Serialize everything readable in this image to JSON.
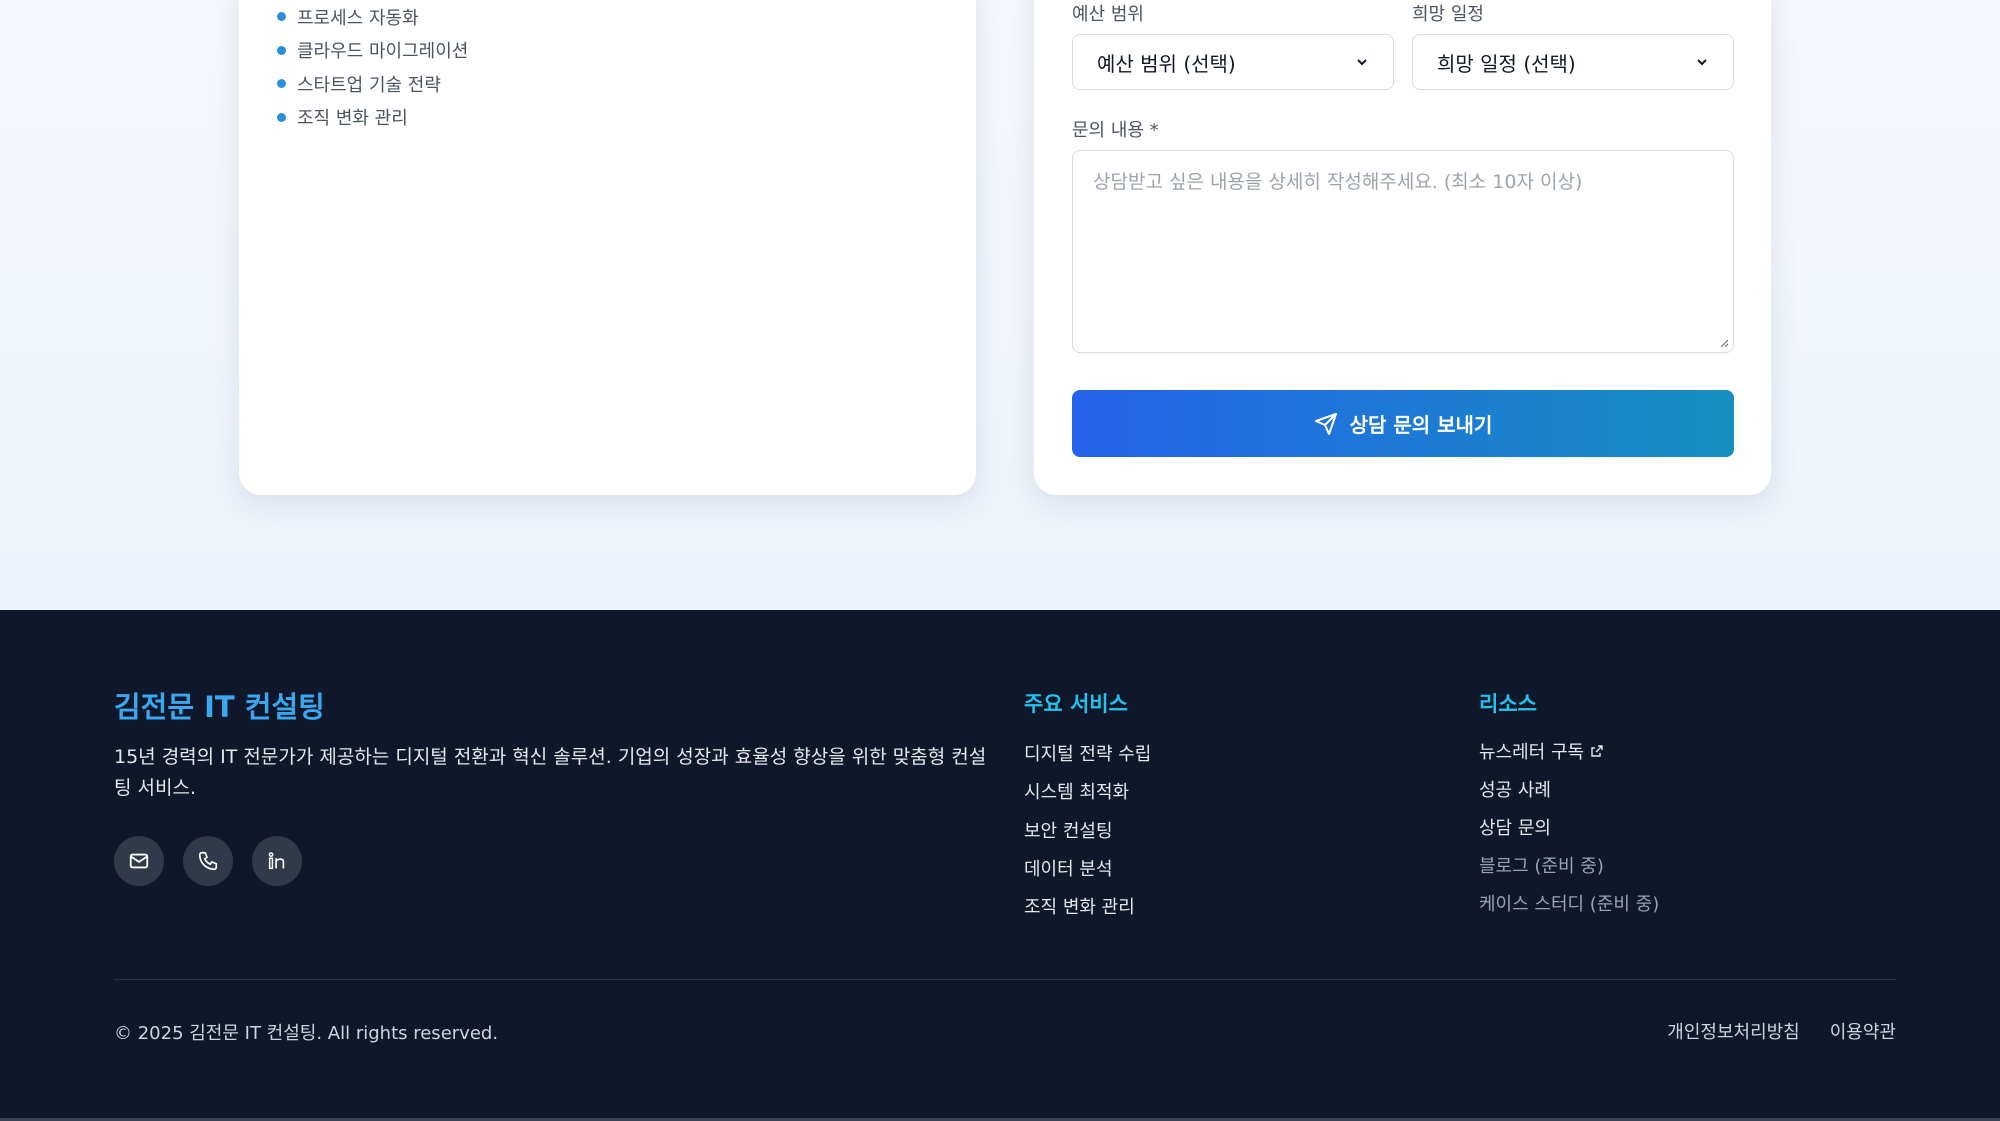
{
  "features": [
    "프로세스 자동화",
    "클라우드 마이그레이션",
    "스타트업 기술 전략",
    "조직 변화 관리"
  ],
  "form": {
    "budget_label": "예산 범위",
    "budget_value": "예산 범위 (선택)",
    "schedule_label": "희망 일정",
    "schedule_value": "희망 일정 (선택)",
    "message_label": "문의 내용 *",
    "message_placeholder": "상담받고 싶은 내용을 상세히 작성해주세요. (최소 10자 이상)",
    "submit_label": "상담 문의 보내기"
  },
  "footer": {
    "brand": "김전문 IT 컨설팅",
    "description": "15년 경력의 IT 전문가가 제공하는 디지털 전환과 혁신 솔루션. 기업의 성장과 효율성 향상을 위한 맞춤형 컨설팅 서비스.",
    "socials": [
      "mail-icon",
      "phone-icon",
      "linkedin-icon"
    ],
    "services_title": "주요 서비스",
    "services": [
      "디지털 전략 수립",
      "시스템 최적화",
      "보안 컨설팅",
      "데이터 분석",
      "조직 변화 관리"
    ],
    "resources_title": "리소스",
    "resources": [
      "뉴스레터 구독",
      "성공 사례",
      "상담 문의",
      "블로그 (준비 중)",
      "케이스 스터디 (준비 중)"
    ],
    "copyright": "© 2025 김전문 IT 컨설팅. All rights reserved.",
    "privacy": "개인정보처리방침",
    "terms": "이용약관"
  },
  "colors": {
    "accent": "#2563eb",
    "accent_end": "#168fc0",
    "footer_bg": "#0f172a",
    "brand": "#3aa7f0",
    "section_title": "#22c3ee"
  }
}
